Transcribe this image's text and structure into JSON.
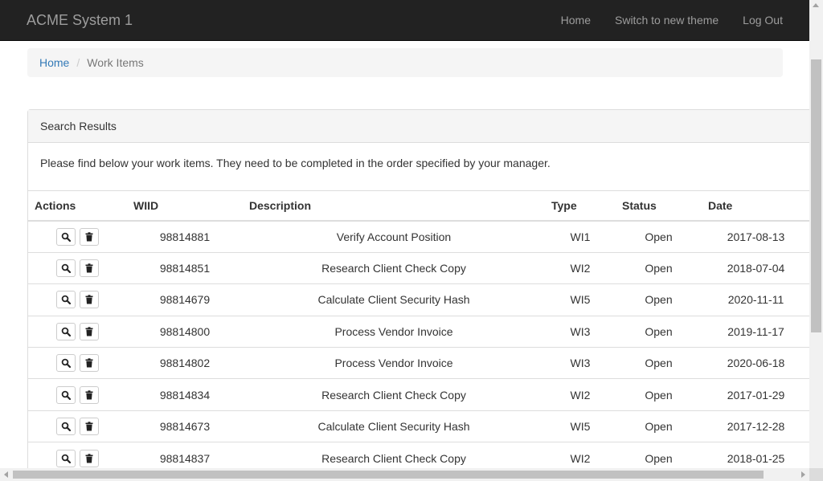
{
  "navbar": {
    "brand": "ACME System 1",
    "links": [
      "Home",
      "Switch to new theme",
      "Log Out"
    ]
  },
  "breadcrumb": {
    "home": "Home",
    "separator": "/",
    "current": "Work Items"
  },
  "panel": {
    "heading": "Search Results",
    "body_text": "Please find below your work items. They need to be completed in the order specified by your manager."
  },
  "table": {
    "columns": [
      "Actions",
      "WIID",
      "Description",
      "Type",
      "Status",
      "Date"
    ],
    "rows": [
      {
        "wiid": "98814881",
        "description": "Verify Account Position",
        "type": "WI1",
        "status": "Open",
        "date": "2017-08-13"
      },
      {
        "wiid": "98814851",
        "description": "Research Client Check Copy",
        "type": "WI2",
        "status": "Open",
        "date": "2018-07-04"
      },
      {
        "wiid": "98814679",
        "description": "Calculate Client Security Hash",
        "type": "WI5",
        "status": "Open",
        "date": "2020-11-11"
      },
      {
        "wiid": "98814800",
        "description": "Process Vendor Invoice",
        "type": "WI3",
        "status": "Open",
        "date": "2019-11-17"
      },
      {
        "wiid": "98814802",
        "description": "Process Vendor Invoice",
        "type": "WI3",
        "status": "Open",
        "date": "2020-06-18"
      },
      {
        "wiid": "98814834",
        "description": "Research Client Check Copy",
        "type": "WI2",
        "status": "Open",
        "date": "2017-01-29"
      },
      {
        "wiid": "98814673",
        "description": "Calculate Client Security Hash",
        "type": "WI5",
        "status": "Open",
        "date": "2017-12-28"
      },
      {
        "wiid": "98814837",
        "description": "Research Client Check Copy",
        "type": "WI2",
        "status": "Open",
        "date": "2018-01-25"
      }
    ]
  },
  "icons": {
    "view": "search-icon",
    "delete": "trash-icon"
  },
  "colors": {
    "navbar_bg": "#222222",
    "navbar_text": "#9d9d9d",
    "link": "#337ab7",
    "panel_heading_bg": "#f5f5f5"
  }
}
